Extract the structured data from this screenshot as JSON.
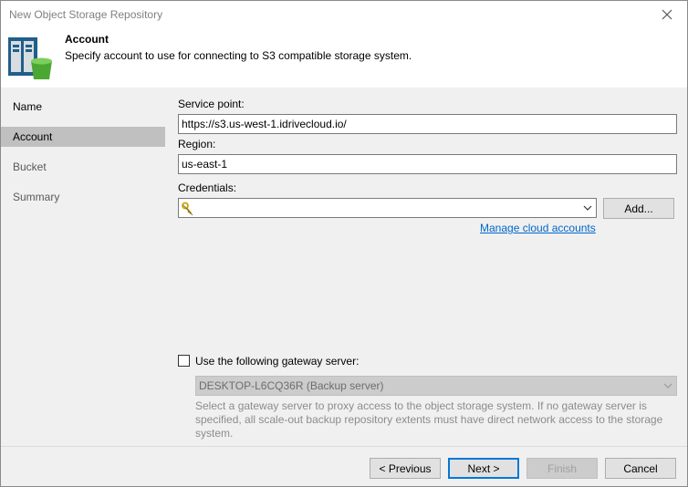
{
  "window": {
    "title": "New Object Storage Repository"
  },
  "header": {
    "title": "Account",
    "description": "Specify account to use for connecting to S3 compatible storage system."
  },
  "sidebar": {
    "items": [
      {
        "label": "Name"
      },
      {
        "label": "Account"
      },
      {
        "label": "Bucket"
      },
      {
        "label": "Summary"
      }
    ]
  },
  "form": {
    "service_point_label": "Service point:",
    "service_point_value": "https://s3.us-west-1.idrivecloud.io/",
    "region_label": "Region:",
    "region_value": "us-east-1",
    "credentials_label": "Credentials:",
    "credentials_value": "",
    "add_button": "Add...",
    "manage_link": "Manage cloud accounts",
    "gateway_checkbox_label": "Use the following gateway server:",
    "gateway_checked": false,
    "gateway_server_value": "DESKTOP-L6CQ36R (Backup server)",
    "gateway_hint": "Select a gateway server to proxy access to the object storage system. If no gateway server is specified, all scale-out backup repository extents must have direct network access to the storage system."
  },
  "footer": {
    "previous": "< Previous",
    "next": "Next >",
    "finish": "Finish",
    "cancel": "Cancel"
  },
  "colors": {
    "link": "#0066cc",
    "active_nav": "#c0c0c0",
    "primary_border": "#0078d7"
  }
}
